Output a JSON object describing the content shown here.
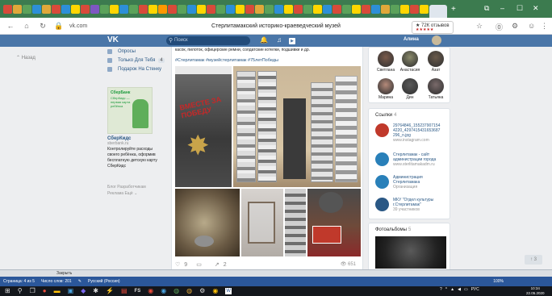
{
  "browser": {
    "tab_colors": [
      "#d84a3a",
      "#e0a83a",
      "#5ba25a",
      "#2d8fd8",
      "#e0a83a",
      "#d84a3a",
      "#2d8fd8",
      "#ffd600",
      "#d84a3a",
      "#7e57c2",
      "#5ba25a",
      "#ffd600",
      "#2d8fd8",
      "#5ba25a",
      "#d84a3a",
      "#ffd600",
      "#ff9800",
      "#d84a3a",
      "#5ba25a",
      "#2d8fd8",
      "#ffd600",
      "#d84a3a",
      "#5ba25a",
      "#2d8fd8",
      "#ffd600",
      "#d84a3a",
      "#e0a83a",
      "#5ba25a",
      "#2d8fd8",
      "#ffd600",
      "#d84a3a",
      "#5ba25a",
      "#ffd600",
      "#2d8fd8",
      "#d84a3a",
      "#5ba25a",
      "#ffd600",
      "#d84a3a",
      "#2d8fd8",
      "#e0a83a",
      "#5ba25a",
      "#ffd600",
      "#d84a3a",
      "#ffd600"
    ],
    "new_tab": "+",
    "url": "vk.com",
    "page_title": "Стерлитамакский историко-краеведческий музей",
    "reviews": "★ 72К отзывов",
    "reviews_stars": "★★★★★",
    "min": "–",
    "max": "☐",
    "close": "✕"
  },
  "vk": {
    "logo": "VK",
    "search_placeholder": "Поиск",
    "user_name": "Алина",
    "notif_icon": "bell-icon",
    "music_icon": "music-icon"
  },
  "left": {
    "back": "Назад"
  },
  "menu": [
    {
      "label": "Опросы"
    },
    {
      "label": "Только Для Тебя",
      "badge": "4"
    },
    {
      "label": "Подарок На Стенку"
    }
  ],
  "ad": {
    "brand": "СберБанк",
    "image_text": "СберКидс — первая карта ребёнка",
    "title": "СберКидс",
    "domain": "sberbank.ru",
    "description": "Контролируйте расходы своего ребёнка, оформив бесплатную детскую карту СберКидс"
  },
  "footer_links": {
    "line1": "Блог   Разработчикам",
    "line2": "Реклама   Ещё ⌄"
  },
  "post": {
    "text": "касок, пилоток, офицерские ремни, солдатские котелки, подшивки и др.",
    "tags": "#Стерлитамак #музейстерлитамак #75летПобеды",
    "poster_title": "ВМЕСТЕ ЗА ПОБЕДУ",
    "likes": "9",
    "comments": "",
    "shares": "2",
    "views": "651"
  },
  "friends": [
    {
      "name": "Светлана",
      "color": "#7a5a4a"
    },
    {
      "name": "Анастасия",
      "color": "#8a8a6a"
    },
    {
      "name": "Азат",
      "color": "#6a5a4a"
    },
    {
      "name": "Марина",
      "color": "#b58a7a"
    },
    {
      "name": "Дин",
      "color": "#5a5a5a"
    },
    {
      "name": "Татьяна",
      "color": "#7a6a6a"
    }
  ],
  "links": {
    "title": "Ссылки",
    "count": "4",
    "items": [
      {
        "title": "29764846_155237907154 4220_4297415431653687 296_n.jpg",
        "sub": "www.instagram.com",
        "color": "#c0392b"
      },
      {
        "title": "Стерлитамак - сайт администрации города",
        "sub": "www.sterlitamakadm.ru",
        "color": "#2980b9"
      },
      {
        "title": "Администрация Стерлитамака",
        "sub": "Организация",
        "color": "#2980b9"
      },
      {
        "title": "МКУ \"Отдел культуры г.Стерлитамак\"",
        "sub": "39 участников",
        "color": "#2a5885"
      }
    ]
  },
  "photos": {
    "title": "Фотоальбомы",
    "count": "5"
  },
  "scrolltop": "↑ 3",
  "close_bar": "Закрыть",
  "word": {
    "page": "Страница: 4 из 5",
    "words": "Число слов: 201",
    "lang": "Русский (Россия)",
    "zoom": "100%"
  },
  "taskbar": {
    "lang": "РУС",
    "time": "10:34",
    "date": "22.05.2020"
  }
}
